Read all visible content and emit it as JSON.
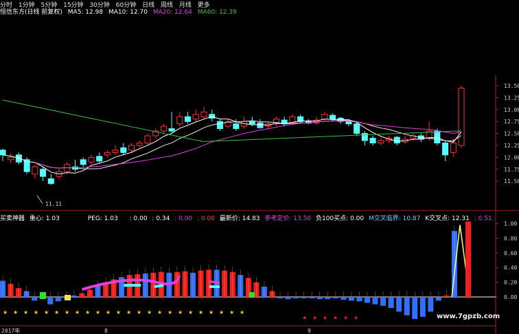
{
  "period_tabs": [
    "分时",
    "1分钟",
    "5分钟",
    "15分钟",
    "30分钟",
    "60分钟",
    "日线",
    "周线",
    "月线",
    "更多"
  ],
  "ma_header": {
    "stock": "恒信东方(日线 前复权)",
    "ma5": "MA5: 12.98",
    "ma10": "MA10: 12.70",
    "ma20": "MA20: 12.64",
    "ma60": "MA60: 12.39",
    "colors": {
      "ma5": "#ffffff",
      "ma10": "#ffffff",
      "ma20": "#e040e0",
      "ma60": "#40c040"
    }
  },
  "price_axis": [
    "13.50",
    "13.25",
    "13.00",
    "12.75",
    "12.50",
    "12.25",
    "12.00",
    "11.75",
    "11.50"
  ],
  "low_label": "11.11",
  "indicator_header": {
    "name": "买卖神器",
    "center": "重心: 1.03",
    "peg": "PEG: 1.03",
    "v1": ": 0.00",
    "v2": ": 0.34",
    "v3": ": 0.00",
    "v4": ": 0.00",
    "latest": "最新价: 14.83",
    "ref": "参考定价: 13.50",
    "neg": "负100买点: 0.00",
    "cross": "M交叉临界: 10.87",
    "kcross": "K交叉点: 12.31",
    "last": ": 0.51"
  },
  "indicator_axis": [
    "1.00",
    "0.80",
    "0.60",
    "0.40",
    "0.20",
    "0.00"
  ],
  "date_labels": [
    "2017年",
    "8",
    "9"
  ],
  "watermark": "www.7gpzb.com",
  "chart_data": {
    "type": "candlestick",
    "ylim": [
      11.1,
      13.6
    ],
    "candles": [
      [
        12.15,
        12.05,
        12.18,
        11.92
      ],
      [
        11.95,
        12.0,
        12.08,
        11.88
      ],
      [
        12.05,
        11.9,
        12.1,
        11.85
      ],
      [
        11.95,
        11.7,
        12.0,
        11.65
      ],
      [
        11.65,
        11.8,
        11.85,
        11.55
      ],
      [
        11.75,
        11.6,
        11.8,
        11.5
      ],
      [
        11.55,
        11.45,
        11.65,
        11.42
      ],
      [
        11.6,
        11.7,
        11.78,
        11.55
      ],
      [
        11.7,
        11.85,
        11.9,
        11.65
      ],
      [
        11.8,
        11.75,
        11.95,
        11.7
      ],
      [
        11.95,
        11.85,
        12.0,
        11.8
      ],
      [
        11.9,
        12.0,
        12.05,
        11.85
      ],
      [
        12.02,
        11.92,
        12.1,
        11.88
      ],
      [
        12.05,
        12.1,
        12.15,
        12.0
      ],
      [
        12.1,
        12.15,
        12.25,
        12.05
      ],
      [
        12.2,
        12.1,
        12.3,
        12.05
      ],
      [
        12.15,
        12.25,
        12.3,
        12.1
      ],
      [
        12.25,
        12.3,
        12.35,
        12.2
      ],
      [
        12.3,
        12.45,
        12.5,
        12.25
      ],
      [
        12.45,
        12.55,
        12.6,
        12.4
      ],
      [
        12.55,
        12.65,
        12.7,
        12.5
      ],
      [
        12.6,
        12.55,
        12.95,
        12.5
      ],
      [
        12.7,
        12.85,
        12.95,
        12.65
      ],
      [
        12.85,
        12.75,
        12.95,
        12.7
      ],
      [
        12.8,
        12.9,
        13.0,
        12.75
      ],
      [
        12.85,
        12.95,
        13.05,
        12.8
      ],
      [
        12.9,
        12.82,
        13.0,
        12.75
      ],
      [
        12.75,
        12.6,
        12.8,
        12.55
      ],
      [
        12.65,
        12.75,
        12.8,
        12.6
      ],
      [
        12.7,
        12.6,
        12.8,
        12.55
      ],
      [
        12.65,
        12.75,
        12.85,
        12.6
      ],
      [
        12.75,
        12.7,
        12.85,
        12.65
      ],
      [
        12.72,
        12.62,
        12.8,
        12.6
      ],
      [
        12.65,
        12.7,
        12.75,
        12.6
      ],
      [
        12.7,
        12.8,
        12.85,
        12.65
      ],
      [
        12.78,
        12.7,
        12.85,
        12.65
      ],
      [
        12.72,
        12.85,
        12.9,
        12.7
      ],
      [
        12.85,
        12.75,
        12.9,
        12.7
      ],
      [
        12.75,
        12.72,
        12.8,
        12.7
      ],
      [
        12.72,
        12.78,
        12.85,
        12.68
      ],
      [
        12.8,
        12.9,
        12.95,
        12.75
      ],
      [
        12.88,
        12.8,
        12.92,
        12.75
      ],
      [
        12.82,
        12.75,
        12.85,
        12.7
      ],
      [
        12.75,
        12.7,
        12.8,
        12.65
      ],
      [
        12.7,
        12.5,
        12.75,
        12.45
      ],
      [
        12.5,
        12.35,
        12.55,
        12.25
      ],
      [
        12.4,
        12.3,
        12.45,
        12.25
      ],
      [
        12.3,
        12.35,
        12.4,
        12.25
      ],
      [
        12.35,
        12.4,
        12.45,
        12.3
      ],
      [
        12.42,
        12.3,
        12.45,
        12.25
      ],
      [
        12.32,
        12.38,
        12.45,
        12.28
      ],
      [
        12.4,
        12.45,
        12.5,
        12.35
      ],
      [
        12.45,
        12.38,
        12.5,
        12.32
      ],
      [
        12.4,
        12.55,
        12.75,
        12.35
      ],
      [
        12.55,
        12.3,
        12.6,
        12.25
      ],
      [
        12.3,
        12.05,
        12.35,
        11.92
      ],
      [
        12.1,
        12.3,
        12.4,
        12.0
      ],
      [
        12.25,
        13.45,
        13.5,
        12.2
      ]
    ]
  }
}
